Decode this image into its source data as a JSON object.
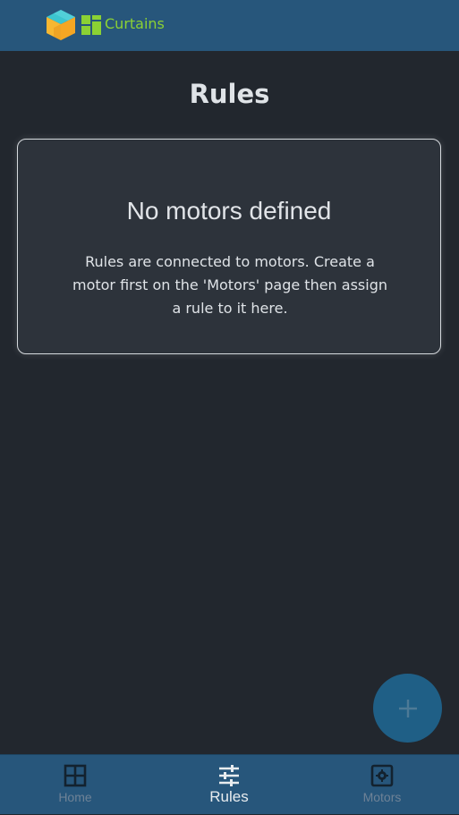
{
  "header": {
    "app_title": "Curtains",
    "logo_icon": "cube-logo-icon",
    "app_icon": "grid-icon"
  },
  "page": {
    "title": "Rules"
  },
  "empty_state": {
    "title": "No motors defined",
    "message": "Rules are connected to motors. Create a motor first on the 'Motors' page then assign a rule to it here."
  },
  "fab": {
    "icon": "plus-icon",
    "label": "+"
  },
  "bottom_nav": {
    "items": [
      {
        "label": "Home",
        "icon": "home-grid-icon",
        "active": false
      },
      {
        "label": "Rules",
        "icon": "sliders-icon",
        "active": true
      },
      {
        "label": "Motors",
        "icon": "motor-gear-icon",
        "active": false
      }
    ]
  },
  "colors": {
    "header_bg": "#27567b",
    "page_bg": "#22272e",
    "card_bg": "#2d333b",
    "accent_green": "#8bd134",
    "fab_bg": "#1f5f86"
  }
}
